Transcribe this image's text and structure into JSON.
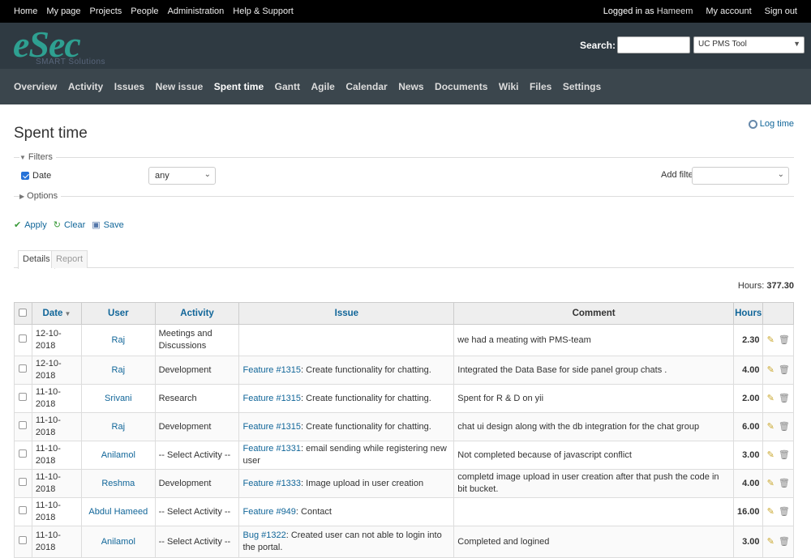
{
  "top_menu": {
    "left": [
      "Home",
      "My page",
      "Projects",
      "People",
      "Administration",
      "Help & Support"
    ],
    "logged_in_prefix": "Logged in as",
    "user": "Hameem",
    "my_account": "My account",
    "sign_out": "Sign out"
  },
  "header": {
    "logo": "eSec",
    "logo_sub": "SMART Solutions",
    "search_label": "Search:",
    "search_value": "",
    "project_select": "UC PMS Tool"
  },
  "main_menu": [
    "Overview",
    "Activity",
    "Issues",
    "New issue",
    "Spent time",
    "Gantt",
    "Agile",
    "Calendar",
    "News",
    "Documents",
    "Wiki",
    "Files",
    "Settings"
  ],
  "main_menu_selected": "Spent time",
  "page": {
    "title": "Spent time",
    "log_time": "Log time",
    "filters_legend": "Filters",
    "date_label": "Date",
    "date_operator": "any",
    "add_filter_label": "Add filter",
    "add_filter_value": "",
    "options_legend": "Options",
    "apply": "Apply",
    "clear": "Clear",
    "save": "Save",
    "tab_details": "Details",
    "tab_report": "Report",
    "hours_label": "Hours:",
    "hours_total": "377.30"
  },
  "table": {
    "headers": {
      "date": "Date",
      "user": "User",
      "activity": "Activity",
      "issue": "Issue",
      "comment": "Comment",
      "hours": "Hours"
    },
    "rows": [
      {
        "date": "12-10-2018",
        "user": "Raj",
        "activity": "Meetings and Discussions",
        "issue_link": "",
        "issue_text": "",
        "comment": "we had a meating with PMS-team",
        "hours": "2.30"
      },
      {
        "date": "12-10-2018",
        "user": "Raj",
        "activity": "Development",
        "issue_link": "Feature #1315",
        "issue_text": ": Create functionality for chatting.",
        "comment": "Integrated the Data Base for side panel group chats .",
        "hours": "4.00"
      },
      {
        "date": "11-10-2018",
        "user": "Srivani",
        "activity": "Research",
        "issue_link": "Feature #1315",
        "issue_text": ": Create functionality for chatting.",
        "comment": "Spent for R & D on yii",
        "hours": "2.00"
      },
      {
        "date": "11-10-2018",
        "user": "Raj",
        "activity": "Development",
        "issue_link": "Feature #1315",
        "issue_text": ": Create functionality for chatting.",
        "comment": "chat ui design along with the db integration for the chat group",
        "hours": "6.00"
      },
      {
        "date": "11-10-2018",
        "user": "Anilamol",
        "activity": "-- Select Activity --",
        "issue_link": "Feature #1331",
        "issue_text": ": email sending while registering new user",
        "comment": "Not completed because of javascript conflict",
        "hours": "3.00"
      },
      {
        "date": "11-10-2018",
        "user": "Reshma",
        "activity": "Development",
        "issue_link": "Feature #1333",
        "issue_text": ": Image upload in user creation",
        "comment": "completd image upload in user creation after that push the code in bit bucket.",
        "hours": "4.00"
      },
      {
        "date": "11-10-2018",
        "user": "Abdul Hameed",
        "activity": "-- Select Activity --",
        "issue_link": "Feature #949",
        "issue_text": ": Contact",
        "comment": "",
        "hours": "16.00"
      },
      {
        "date": "11-10-2018",
        "user": "Anilamol",
        "activity": "-- Select Activity --",
        "issue_link": "Bug #1322",
        "issue_text": ": Created user can not able to login into the portal.",
        "comment": "Completed and logined",
        "hours": "3.00"
      }
    ]
  }
}
